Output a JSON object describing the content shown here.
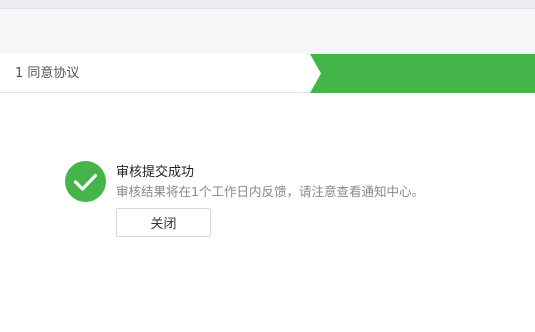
{
  "steps": {
    "step1_label": "1 同意协议"
  },
  "result": {
    "title": "审核提交成功",
    "description": "审核结果将在1个工作日内反馈，请注意查看通知中心。",
    "close_label": "关闭"
  },
  "colors": {
    "success_green": "#46b549",
    "step_active_green": "#44b549"
  },
  "icons": {
    "success": "check-circle-icon"
  }
}
